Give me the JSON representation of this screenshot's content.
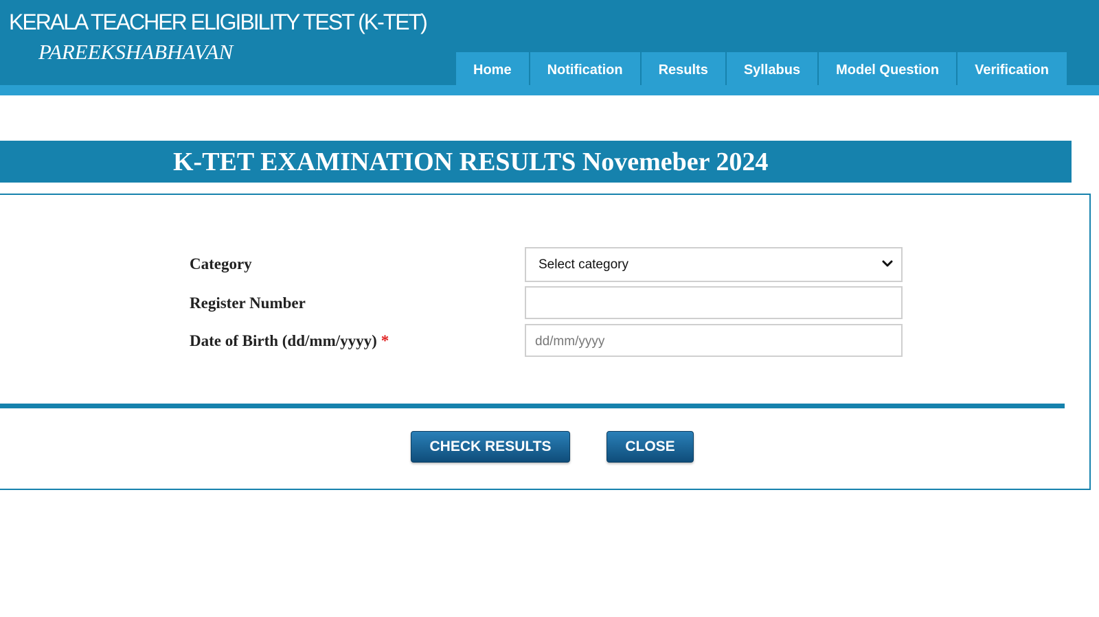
{
  "header": {
    "title": "KERALA TEACHER ELIGIBILITY TEST (K-TET)",
    "subtitle": "PAREEKSHABHAVAN"
  },
  "nav": {
    "items": [
      {
        "label": "Home"
      },
      {
        "label": "Notification"
      },
      {
        "label": "Results"
      },
      {
        "label": "Syllabus"
      },
      {
        "label": "Model Question"
      },
      {
        "label": "Verification"
      }
    ]
  },
  "result_banner": {
    "title": "K-TET EXAMINATION RESULTS Novemeber 2024"
  },
  "form": {
    "category_label": "Category",
    "category_selected": "Select category",
    "register_label": "Register Number",
    "register_value": "",
    "dob_label": "Date of Birth (dd/mm/yyyy)",
    "dob_required_mark": "*",
    "dob_placeholder": "dd/mm/yyyy"
  },
  "buttons": {
    "check_results": "CHECK RESULTS",
    "close": "CLOSE"
  },
  "colors": {
    "header_bg": "#1682ad",
    "nav_bg": "#2a9fd1",
    "button_bg": "#0f4d7a",
    "required": "#e02020"
  },
  "icons": {
    "select_arrow": "chevron-down-icon"
  }
}
